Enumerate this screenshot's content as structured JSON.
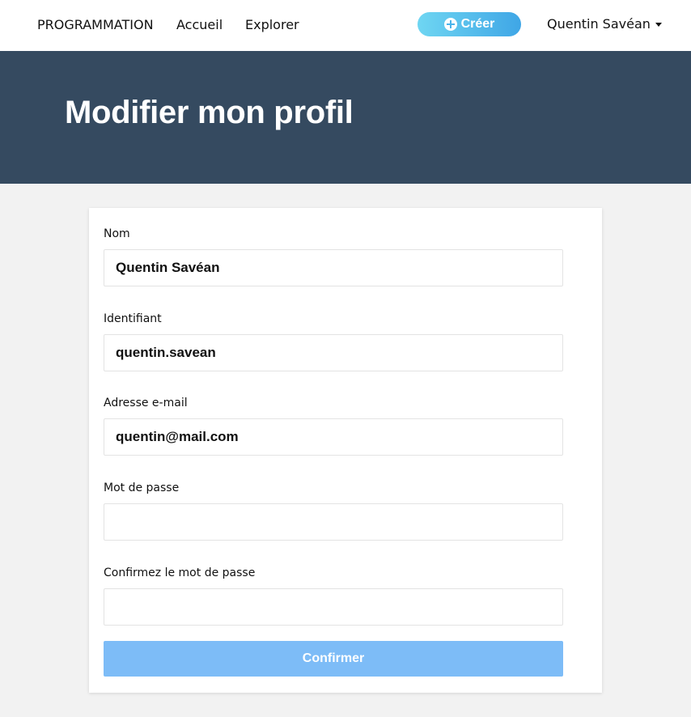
{
  "nav": {
    "brand": "PROGRAMMATION",
    "links": [
      "Accueil",
      "Explorer"
    ],
    "create_label": "Créer",
    "create_icon": "plus-circle-icon",
    "user_name": "Quentin Savéan",
    "user_caret_icon": "caret-down-icon"
  },
  "hero": {
    "title": "Modifier mon profil"
  },
  "form": {
    "fields": [
      {
        "label": "Nom",
        "value": "Quentin Savéan"
      },
      {
        "label": "Identifiant",
        "value": "quentin.savean"
      },
      {
        "label": "Adresse e-mail",
        "value": "quentin@mail.com"
      },
      {
        "label": "Mot de passe",
        "value": ""
      },
      {
        "label": "Confirmez le mot de passe",
        "value": ""
      }
    ],
    "submit_label": "Confirmer"
  },
  "colors": {
    "navbar_bg": "#ffffff",
    "hero_bg": "#354a60",
    "page_bg": "#f2f2f2",
    "create_gradient_start": "#6fd6f2",
    "create_gradient_end": "#3fa6e6",
    "submit_bg": "#7dbcf7"
  }
}
